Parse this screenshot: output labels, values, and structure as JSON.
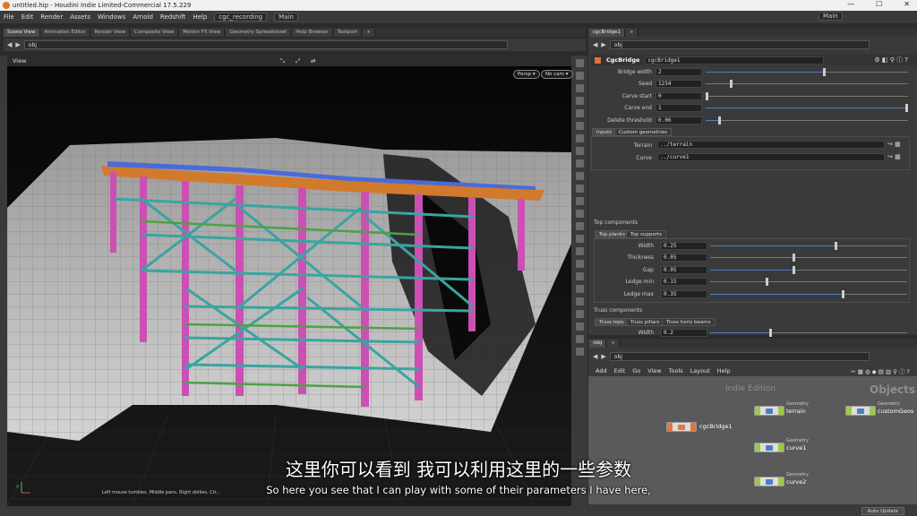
{
  "window": {
    "title": "untitled.hip - Houdini Indie Limited-Commercial 17.5.229",
    "controls": [
      "—",
      "☐",
      "✕"
    ]
  },
  "menubar": {
    "items": [
      "File",
      "Edit",
      "Render",
      "Assets",
      "Windows",
      "Arnold",
      "Redshift",
      "Help"
    ],
    "shelf": "cgc_recording",
    "desktop": "Main",
    "right_desktop": "Main"
  },
  "left_pane": {
    "tabs": [
      "Scene View",
      "Animation Editor",
      "Render View",
      "Composite View",
      "Motion FX View",
      "Geometry Spreadsheet",
      "Help Browser",
      "Textport"
    ],
    "path": "obj",
    "viewport_label": "View",
    "persp_button": "Persp ▾",
    "cam_button": "No cam ▾",
    "hint": "Left mouse tumbles. Middle pans. Right dollies. Ctr...",
    "axis_y": "y"
  },
  "param_pane": {
    "tab": "cgcBridge1",
    "path": "obj",
    "node_type": "CgcBridge",
    "node_name": "cgcBridge1",
    "params": [
      {
        "label": "Bridge width",
        "value": "2",
        "fraction": 0.58
      },
      {
        "label": "Seed",
        "value": "1234",
        "fraction": 0.12
      },
      {
        "label": "Carve start",
        "value": "0",
        "fraction": 0.0
      },
      {
        "label": "Carve end",
        "value": "1",
        "fraction": 1.0
      },
      {
        "label": "Delete threshold",
        "value": "0.06",
        "fraction": 0.06
      }
    ],
    "input_tabs": [
      "Inputs",
      "Custom geometries"
    ],
    "inputs": [
      {
        "label": "Terrain",
        "value": "../terrain"
      },
      {
        "label": "Curve",
        "value": "../curve1"
      }
    ],
    "top_components": {
      "title": "Top components",
      "tabs": [
        "Top planks",
        "Top supports"
      ],
      "params": [
        {
          "label": "Width",
          "value": "0.25",
          "fraction": 0.63
        },
        {
          "label": "Thickness",
          "value": "0.05",
          "fraction": 0.42
        },
        {
          "label": "Gap",
          "value": "0.05",
          "fraction": 0.42
        },
        {
          "label": "Ledge min",
          "value": "0.15",
          "fraction": 0.28
        },
        {
          "label": "Ledge max",
          "value": "0.35",
          "fraction": 0.67
        }
      ]
    },
    "truss_components": {
      "title": "Truss components",
      "tabs": [
        "Truss tops",
        "Truss pillars",
        "Truss horiz beams"
      ],
      "params": [
        {
          "label": "Width",
          "value": "0.2",
          "fraction": 0.3
        }
      ]
    }
  },
  "network_pane": {
    "tab": "/obj",
    "path": "obj",
    "menu": [
      "Add",
      "Edit",
      "Go",
      "View",
      "Tools",
      "Layout",
      "Help"
    ],
    "watermark_edition": "Indie Edition",
    "watermark_context": "Objects",
    "nodes": [
      {
        "name": "cgcBridge1",
        "type": ""
      },
      {
        "name": "terrain",
        "type": "Geometry"
      },
      {
        "name": "customGeos",
        "type": "Geometry"
      },
      {
        "name": "curve1",
        "type": "Geometry"
      },
      {
        "name": "curve2",
        "type": "Geometry"
      }
    ]
  },
  "status": {
    "auto_update": "Auto Update"
  },
  "subtitles": {
    "chinese": "这里你可以看到 我可以利用这里的一些参数",
    "english": "So here you see that I can play with some of their parameters I have here,"
  }
}
